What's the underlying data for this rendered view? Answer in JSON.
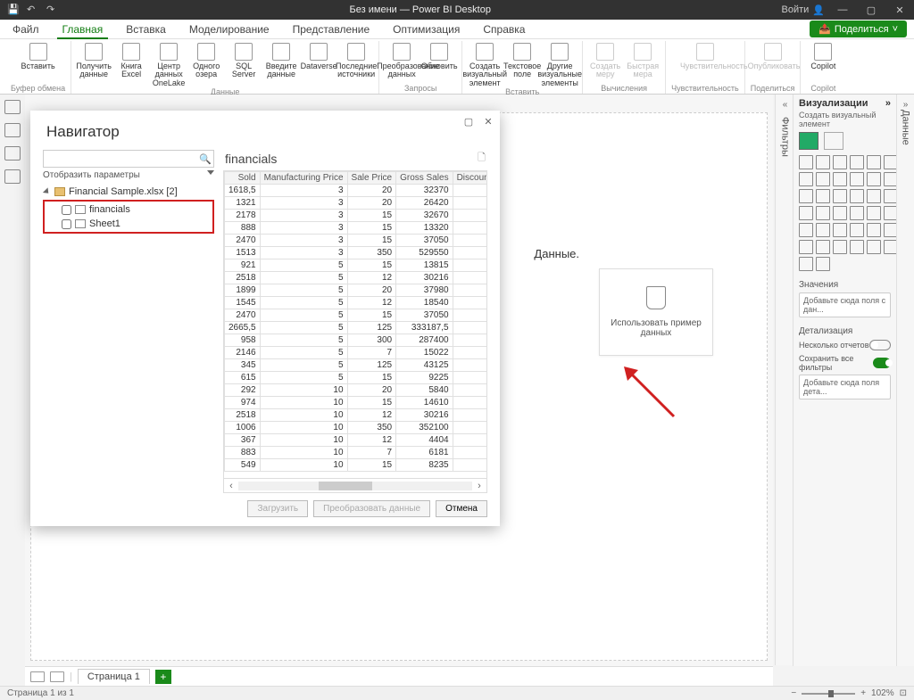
{
  "titlebar": {
    "title": "Без имени — Power BI Desktop",
    "login": "Войти"
  },
  "menu": {
    "items": [
      "Файл",
      "Главная",
      "Вставка",
      "Моделирование",
      "Представление",
      "Оптимизация",
      "Справка"
    ],
    "active_index": 1,
    "share": "Поделиться"
  },
  "ribbon": {
    "groups": [
      {
        "name": "Буфер обмена",
        "buttons": [
          {
            "label": "Вставить"
          }
        ]
      },
      {
        "name": "Данные",
        "buttons": [
          {
            "label": "Получить данные"
          },
          {
            "label": "Книга Excel"
          },
          {
            "label": "Центр данных OneLake"
          },
          {
            "label": "Одного озера"
          },
          {
            "label": "SQL Server"
          },
          {
            "label": "Введите данные"
          },
          {
            "label": "Dataverse"
          },
          {
            "label": "Последние источники"
          }
        ]
      },
      {
        "name": "Запросы",
        "buttons": [
          {
            "label": "Преобразование данных"
          },
          {
            "label": "Обновить"
          }
        ]
      },
      {
        "name": "Вставить",
        "buttons": [
          {
            "label": "Создать визуальный элемент"
          },
          {
            "label": "Текстовое поле"
          },
          {
            "label": "Другие визуальные элементы"
          }
        ]
      },
      {
        "name": "Вычисления",
        "buttons": [
          {
            "label": "Создать меру",
            "disabled": true
          },
          {
            "label": "Быстрая мера",
            "disabled": true
          }
        ]
      },
      {
        "name": "Чувствительность",
        "buttons": [
          {
            "label": "Чувствительность",
            "disabled": true
          }
        ]
      },
      {
        "name": "Поделиться",
        "buttons": [
          {
            "label": "Опубликовать",
            "disabled": true
          }
        ]
      },
      {
        "name": "Copilot",
        "buttons": [
          {
            "label": "Copilot"
          }
        ]
      }
    ]
  },
  "canvas": {
    "heading": "Данные.",
    "sample_card": "Использовать пример данных"
  },
  "filters_label": "Фильтры",
  "viz": {
    "title": "Визуализации",
    "subtitle": "Создать визуальный элемент",
    "values": "Значения",
    "drop_values": "Добавьте сюда поля с дан...",
    "drill": "Детализация",
    "cross": "Несколько отчетов",
    "keep": "Сохранить все фильтры",
    "drop_drill": "Добавьте сюда поля дета..."
  },
  "data_label": "Данные",
  "tabs": {
    "page": "Страница 1"
  },
  "status": {
    "page": "Страница 1 из 1",
    "zoom": "102%"
  },
  "navigator": {
    "title": "Навигатор",
    "params": "Отобразить параметры",
    "file": "Financial Sample.xlsx [2]",
    "sheets": [
      "financials",
      "Sheet1"
    ],
    "preview_name": "financials",
    "columns": [
      "Sold",
      "Manufacturing Price",
      "Sale Price",
      "Gross Sales",
      "Discount"
    ],
    "rows": [
      [
        "1618,5",
        "3",
        "20",
        "32370",
        ""
      ],
      [
        "1321",
        "3",
        "20",
        "26420",
        ""
      ],
      [
        "2178",
        "3",
        "15",
        "32670",
        ""
      ],
      [
        "888",
        "3",
        "15",
        "13320",
        ""
      ],
      [
        "2470",
        "3",
        "15",
        "37050",
        ""
      ],
      [
        "1513",
        "3",
        "350",
        "529550",
        ""
      ],
      [
        "921",
        "5",
        "15",
        "13815",
        ""
      ],
      [
        "2518",
        "5",
        "12",
        "30216",
        ""
      ],
      [
        "1899",
        "5",
        "20",
        "37980",
        ""
      ],
      [
        "1545",
        "5",
        "12",
        "18540",
        ""
      ],
      [
        "2470",
        "5",
        "15",
        "37050",
        ""
      ],
      [
        "2665,5",
        "5",
        "125",
        "333187,5",
        ""
      ],
      [
        "958",
        "5",
        "300",
        "287400",
        ""
      ],
      [
        "2146",
        "5",
        "7",
        "15022",
        ""
      ],
      [
        "345",
        "5",
        "125",
        "43125",
        ""
      ],
      [
        "615",
        "5",
        "15",
        "9225",
        ""
      ],
      [
        "292",
        "10",
        "20",
        "5840",
        ""
      ],
      [
        "974",
        "10",
        "15",
        "14610",
        ""
      ],
      [
        "2518",
        "10",
        "12",
        "30216",
        ""
      ],
      [
        "1006",
        "10",
        "350",
        "352100",
        ""
      ],
      [
        "367",
        "10",
        "12",
        "4404",
        ""
      ],
      [
        "883",
        "10",
        "7",
        "6181",
        ""
      ],
      [
        "549",
        "10",
        "15",
        "8235",
        ""
      ]
    ],
    "buttons": {
      "load": "Загрузить",
      "transform": "Преобразовать данные",
      "cancel": "Отмена"
    }
  }
}
